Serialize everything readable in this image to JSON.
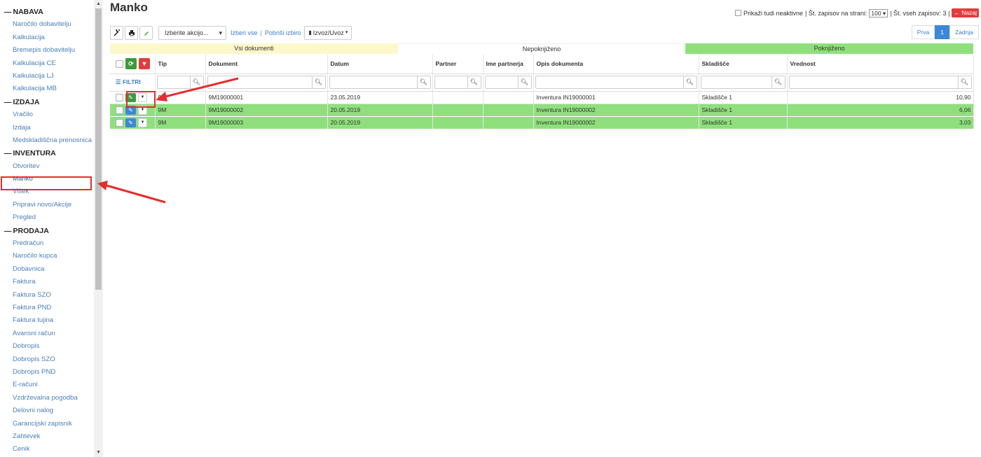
{
  "sidebar": {
    "sections": [
      {
        "title": "NABAVA",
        "items": [
          "Naročilo dobavitelju",
          "Kalkulacija",
          "Bremepis dobavitelju",
          "Kalkulacija CE",
          "Kalkulacija LJ",
          "Kalkulacija MB"
        ]
      },
      {
        "title": "IZDAJA",
        "items": [
          "Vračilo",
          "Izdaja",
          "Medskladiščna prenosnica"
        ]
      },
      {
        "title": "INVENTURA",
        "items": [
          "Otvoritev",
          "Manko",
          "Višek",
          "Pripravi novo/Akcije",
          "Pregled"
        ]
      },
      {
        "title": "PRODAJA",
        "items": [
          "Predračun",
          "Naročilo kupca",
          "Dobavnica",
          "Faktura",
          "Faktura SZO",
          "Faktura PND",
          "Faktura tujina",
          "Avansni račun",
          "Dobropis",
          "Dobropis SZO",
          "Dobropis PND",
          "E-računi",
          "Vzdrževalna pogodba",
          "Delovni nalog",
          "Garancijski zapisnik",
          "Zahtevek",
          "Cenik"
        ]
      }
    ],
    "section_prefix": "—",
    "active_item": "Manko"
  },
  "header": {
    "title": "Manko",
    "show_inactive_label": "Prikaži tudi neaktivne",
    "per_page_label": "| Št. zapisov na strani:",
    "per_page_value": "100 ▾",
    "total_label": "| Št. vseh zapisov: 3 |",
    "back_label": "← Nazaj"
  },
  "toolbar": {
    "action_select": "Izberite akcijo...",
    "select_all": "Izberi vse",
    "clear_selection": "Pobriši izbiro",
    "separator": "|",
    "export": "Izvoz/Uvoz"
  },
  "pager": {
    "first": "Prva",
    "current": "1",
    "last": "Zadnja"
  },
  "status_filter": {
    "all": "Vsi dokumenti",
    "unposted": "Nepoknjiženo",
    "posted": "Poknjiženo"
  },
  "table": {
    "filters_label": "FILTRI",
    "columns": [
      "Tip",
      "Dokument",
      "Datum",
      "Partner",
      "Ime partnerja",
      "Opis dokumenta",
      "Skladišče",
      "Vrednost"
    ],
    "rows": [
      {
        "tip": "9M",
        "dokument": "9M19000001",
        "datum": "23.05.2019",
        "partner": "",
        "ime": "",
        "opis": "Inventura IN19000001",
        "skladisce": "Skladišče 1",
        "vrednost": "10,90",
        "posted": false
      },
      {
        "tip": "9M",
        "dokument": "9M19000002",
        "datum": "20.05.2019",
        "partner": "",
        "ime": "",
        "opis": "Inventura IN19000002",
        "skladisce": "Skladišče 1",
        "vrednost": "6,06",
        "posted": true
      },
      {
        "tip": "9M",
        "dokument": "9M19000003",
        "datum": "20.05.2019",
        "partner": "",
        "ime": "",
        "opis": "Inventura IN19000002",
        "skladisce": "Skladišče 1",
        "vrednost": "3,03",
        "posted": true
      }
    ]
  },
  "colors": {
    "posted_row": "#8fe07c",
    "all_docs": "#fdf8cc",
    "annotation": "#e52d2d",
    "link": "#4a7fb5"
  }
}
